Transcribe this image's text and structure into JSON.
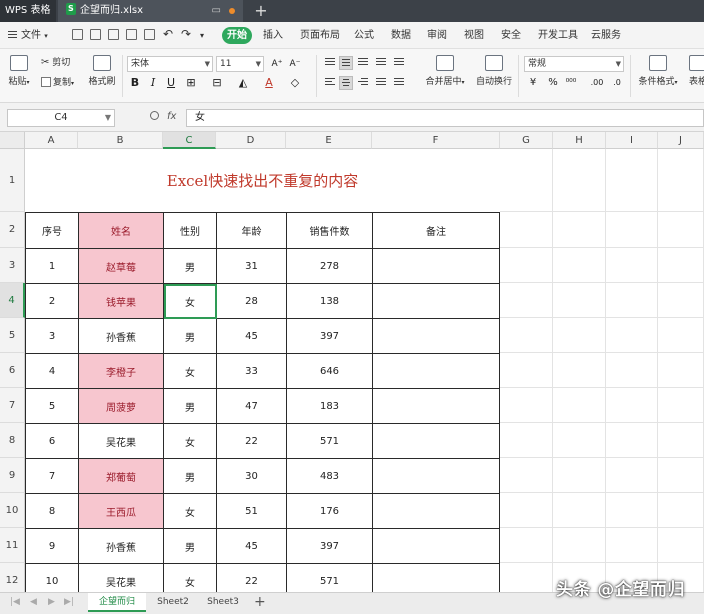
{
  "window": {
    "app_tab": "WPS 表格",
    "doc_tab": "企望而归.xlsx"
  },
  "menu": {
    "file": "文件",
    "tabs": [
      "开始",
      "插入",
      "页面布局",
      "公式",
      "数据",
      "审阅",
      "视图",
      "安全",
      "开发工具",
      "云服务"
    ]
  },
  "ribbon": {
    "paste": "粘贴",
    "cut": "剪切",
    "copy": "复制",
    "format_painter": "格式刷",
    "font_name": "宋体",
    "font_size": "11",
    "merge_center": "合并居中",
    "wrap_text": "自动换行",
    "number_format": "常规",
    "conditional_format": "条件格式",
    "table_style": "表格"
  },
  "formula_bar": {
    "cell_ref": "C4",
    "fx": "fx",
    "value": "女"
  },
  "grid": {
    "columns": [
      "A",
      "B",
      "C",
      "D",
      "E",
      "F",
      "G",
      "H",
      "I",
      "J"
    ],
    "rows": [
      "1",
      "2",
      "3",
      "4",
      "5",
      "6",
      "7",
      "8",
      "9",
      "10",
      "11",
      "12"
    ],
    "active_cell": "C4",
    "title": "Excel快速找出不重复的内容",
    "header": [
      "序号",
      "姓名",
      "性别",
      "年龄",
      "销售件数",
      "备注"
    ],
    "data": [
      [
        "1",
        "赵草莓",
        "男",
        "31",
        "278",
        ""
      ],
      [
        "2",
        "钱苹果",
        "女",
        "28",
        "138",
        ""
      ],
      [
        "3",
        "孙香蕉",
        "男",
        "45",
        "397",
        ""
      ],
      [
        "4",
        "李橙子",
        "女",
        "33",
        "646",
        ""
      ],
      [
        "5",
        "周菠萝",
        "男",
        "47",
        "183",
        ""
      ],
      [
        "6",
        "吴花果",
        "女",
        "22",
        "571",
        ""
      ],
      [
        "7",
        "郑葡萄",
        "男",
        "30",
        "483",
        ""
      ],
      [
        "8",
        "王西瓜",
        "女",
        "51",
        "176",
        ""
      ],
      [
        "9",
        "孙香蕉",
        "男",
        "45",
        "397",
        ""
      ],
      [
        "10",
        "吴花果",
        "女",
        "22",
        "571",
        ""
      ]
    ],
    "highlight_color": "#f7c6cf",
    "highlight_text_color": "#9b1c2c",
    "title_color": "#c0392b"
  },
  "sheets": {
    "tabs": [
      "企望而归",
      "Sheet2",
      "Sheet3"
    ],
    "active": "企望而归"
  },
  "watermark": "头条 @企望而归"
}
